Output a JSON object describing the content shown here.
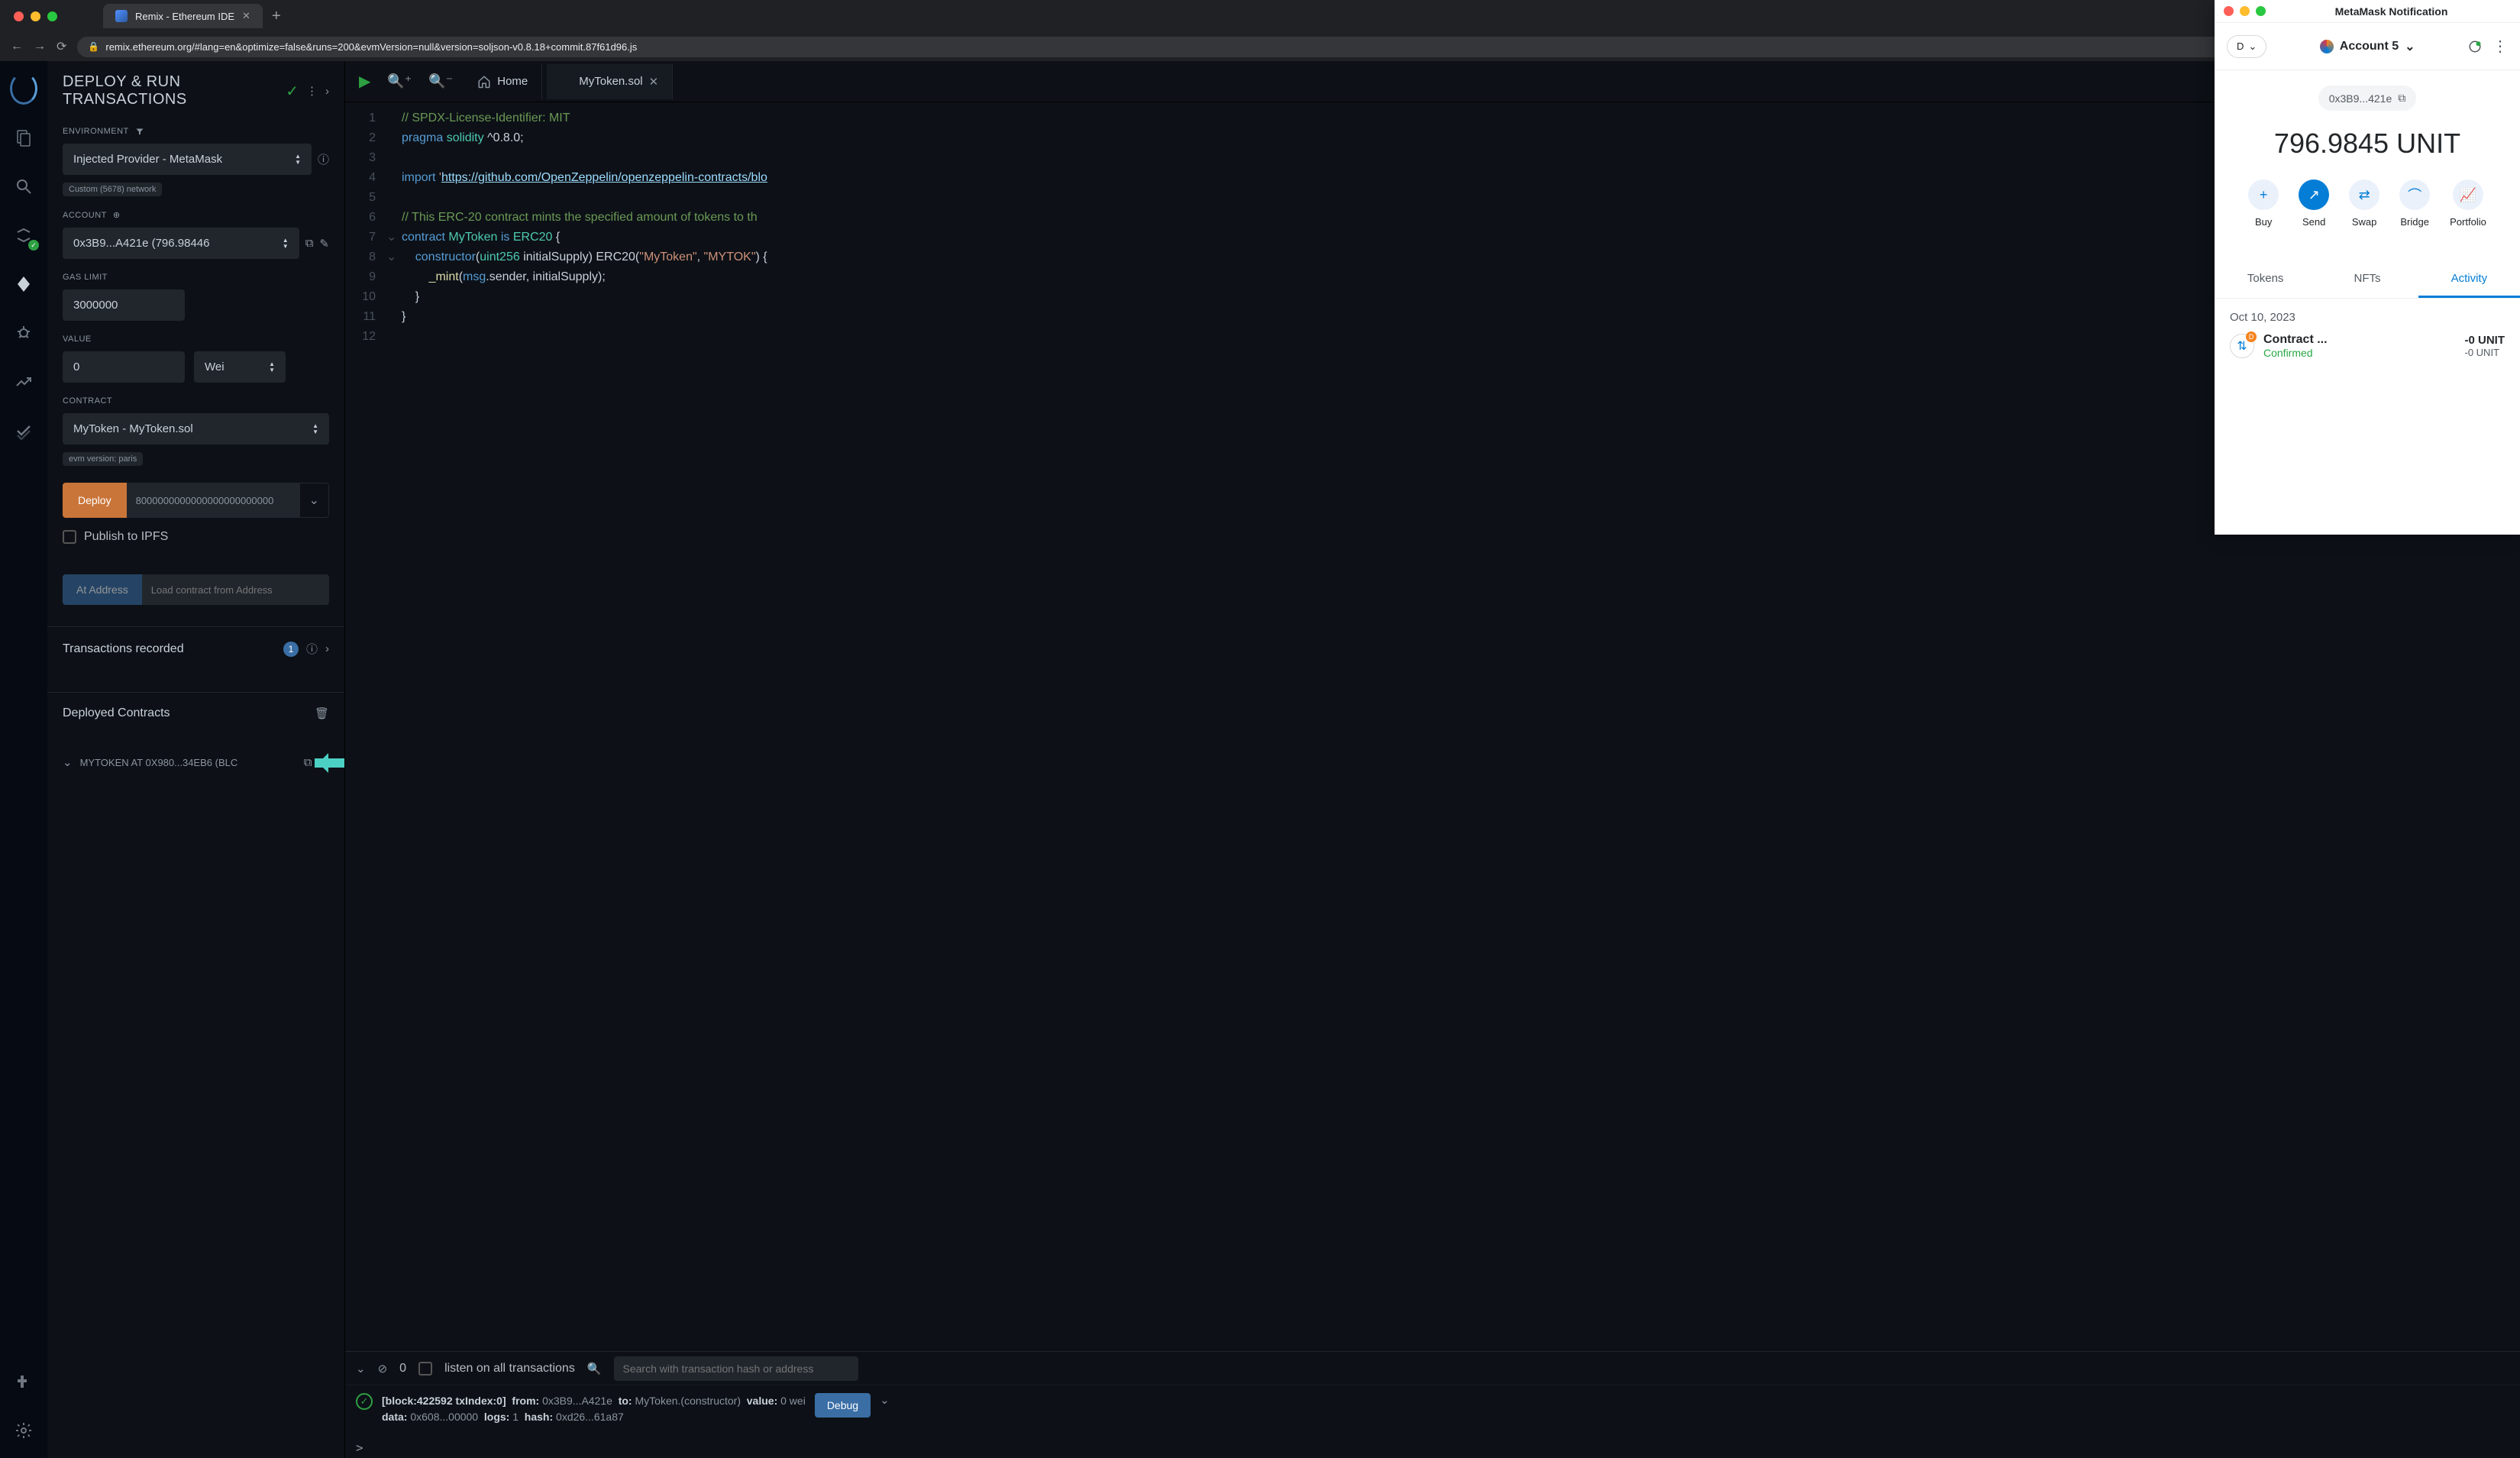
{
  "browser": {
    "tab_title": "Remix - Ethereum IDE",
    "url": "remix.ethereum.org/#lang=en&optimize=false&runs=200&evmVersion=null&version=soljson-v0.8.18+commit.87f61d96.js"
  },
  "panel": {
    "title": "DEPLOY & RUN TRANSACTIONS",
    "environment_label": "ENVIRONMENT",
    "environment_value": "Injected Provider - MetaMask",
    "network_chip": "Custom (5678) network",
    "account_label": "ACCOUNT",
    "account_value": "0x3B9...A421e (796.98446",
    "gas_label": "GAS LIMIT",
    "gas_value": "3000000",
    "value_label": "VALUE",
    "value_value": "0",
    "value_unit": "Wei",
    "contract_label": "CONTRACT",
    "contract_value": "MyToken - MyToken.sol",
    "evm_chip": "evm version: paris",
    "deploy_btn": "Deploy",
    "deploy_input": "8000000000000000000000000",
    "publish_ipfs": "Publish to IPFS",
    "at_address_btn": "At Address",
    "at_address_placeholder": "Load contract from Address",
    "tx_recorded": "Transactions recorded",
    "tx_count": "1",
    "deployed_title": "Deployed Contracts",
    "deployed_item": "MYTOKEN AT 0X980...34EB6 (BLC"
  },
  "editor": {
    "home_tab": "Home",
    "file_tab": "MyToken.sol",
    "code": {
      "l1": "// SPDX-License-Identifier: MIT",
      "l2a": "pragma",
      "l2b": "solidity",
      "l2c": "^0.8.0;",
      "l4a": "import",
      "l4b": "'",
      "l4c": "https://github.com/OpenZeppelin/openzeppelin-contracts/blo",
      "l6": "// This ERC-20 contract mints the specified amount of tokens to th",
      "l7a": "contract",
      "l7b": "MyToken",
      "l7c": "is",
      "l7d": "ERC20",
      "l7e": "{",
      "l8a": "constructor",
      "l8b": "(",
      "l8c": "uint256",
      "l8d": " initialSupply",
      "l8e": ")",
      "l8f": " ERC20(",
      "l8g": "\"MyToken\"",
      "l8h": ", ",
      "l8i": "\"MYTOK\"",
      "l8j": ") {",
      "l9a": "_mint",
      "l9b": "(",
      "l9c": "msg",
      "l9d": ".sender, initialSupply",
      "l9e": ");",
      "l10": "}",
      "l11": "}"
    }
  },
  "terminal": {
    "pending_count": "0",
    "listen_label": "listen on all transactions",
    "search_placeholder": "Search with transaction hash or address",
    "debug_btn": "Debug",
    "log_block": "[block:422592 txIndex:0]",
    "log_from_label": "from:",
    "log_from": "0x3B9...A421e",
    "log_to_label": "to:",
    "log_to": "MyToken.(constructor)",
    "log_value_label": "value:",
    "log_value": "0 wei",
    "log_data_label": "data:",
    "log_data": "0x608...00000",
    "log_logs_label": "logs:",
    "log_logs": "1",
    "log_hash_label": "hash:",
    "log_hash": "0xd26...61a87",
    "prompt": ">"
  },
  "metamask": {
    "window_title": "MetaMask Notification",
    "network_letter": "D",
    "account_name": "Account 5",
    "address_short": "0x3B9...421e",
    "balance": "796.9845 UNIT",
    "actions": {
      "buy": "Buy",
      "send": "Send",
      "swap": "Swap",
      "bridge": "Bridge",
      "portfolio": "Portfolio"
    },
    "tabs": {
      "tokens": "Tokens",
      "nfts": "NFTs",
      "activity": "Activity"
    },
    "activity_date": "Oct 10, 2023",
    "txn_title": "Contract ...",
    "txn_status": "Confirmed",
    "txn_amount": "-0 UNIT",
    "txn_sub": "-0 UNIT"
  }
}
